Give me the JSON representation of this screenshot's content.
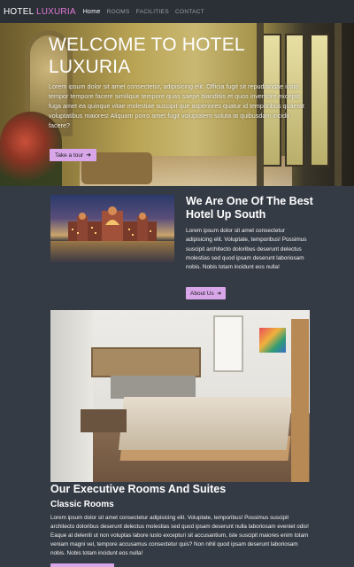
{
  "nav": {
    "brand_a": "HOTEL",
    "brand_b": "LUXURIA",
    "links": [
      "Home",
      "ROOMS",
      "FACILITIES",
      "CONTACT"
    ]
  },
  "hero": {
    "title": "WELCOME TO HOTEL LUXURIA",
    "text": "Lorem ipsum dolor sit amet consectetur, adipisicing elit. Officia fugit sit repudiandae iusto tempor tempore facere similique tempore quas saepe blanditiis et quos inventore excepto fuga amet ea quinque vitae molestiae suscipit que asperiores quatur id temporibus quaerat voluptatibus maiores! Aliquam porro amet fugit voluptatem soluta at quibusdam incidit facere?",
    "button": "Take a tour",
    "button_icon": "arrow-right-icon"
  },
  "about": {
    "title": "We Are One Of The Best Hotel Up South",
    "text": "Lorem ipsum dolor sit amet consectetur adipisicing elit. Voluptate, temporibus! Possimus suscipit architecto doloribus deserunt delectus molestias sed quod ipsam deserunt laboriosam nobis. Nobis totam incidunt eos nulla!",
    "button": "About Us",
    "button_icon": "arrow-right-icon"
  },
  "rooms": {
    "title": "Our Executive Rooms And Suites",
    "subtitle": "Classic Rooms",
    "text": "Lorem ipsum dolor sit amet consectetur adipisicing elit. Voluptate, temporibus! Possimus suscipit architecto doloribus deserunt delectus molestias sed quod ipsam deserunt nulla laboriosam eveniet odio! Eaque at deleniti ut non voluptas labore iusto excepturi sit accusantium, iste suscipit maiores enim totam veniam magni vel, tempore accusamus consectetur quis? Non nihil quod ipsam deserunt laboriosam nobis. Nobis totam incidunt eos nulla!"
  },
  "colors": {
    "accent": "#d9a7e9",
    "brand_accent": "#e07ad8",
    "page_bg": "#353b45",
    "nav_bg": "#2b2f36"
  }
}
